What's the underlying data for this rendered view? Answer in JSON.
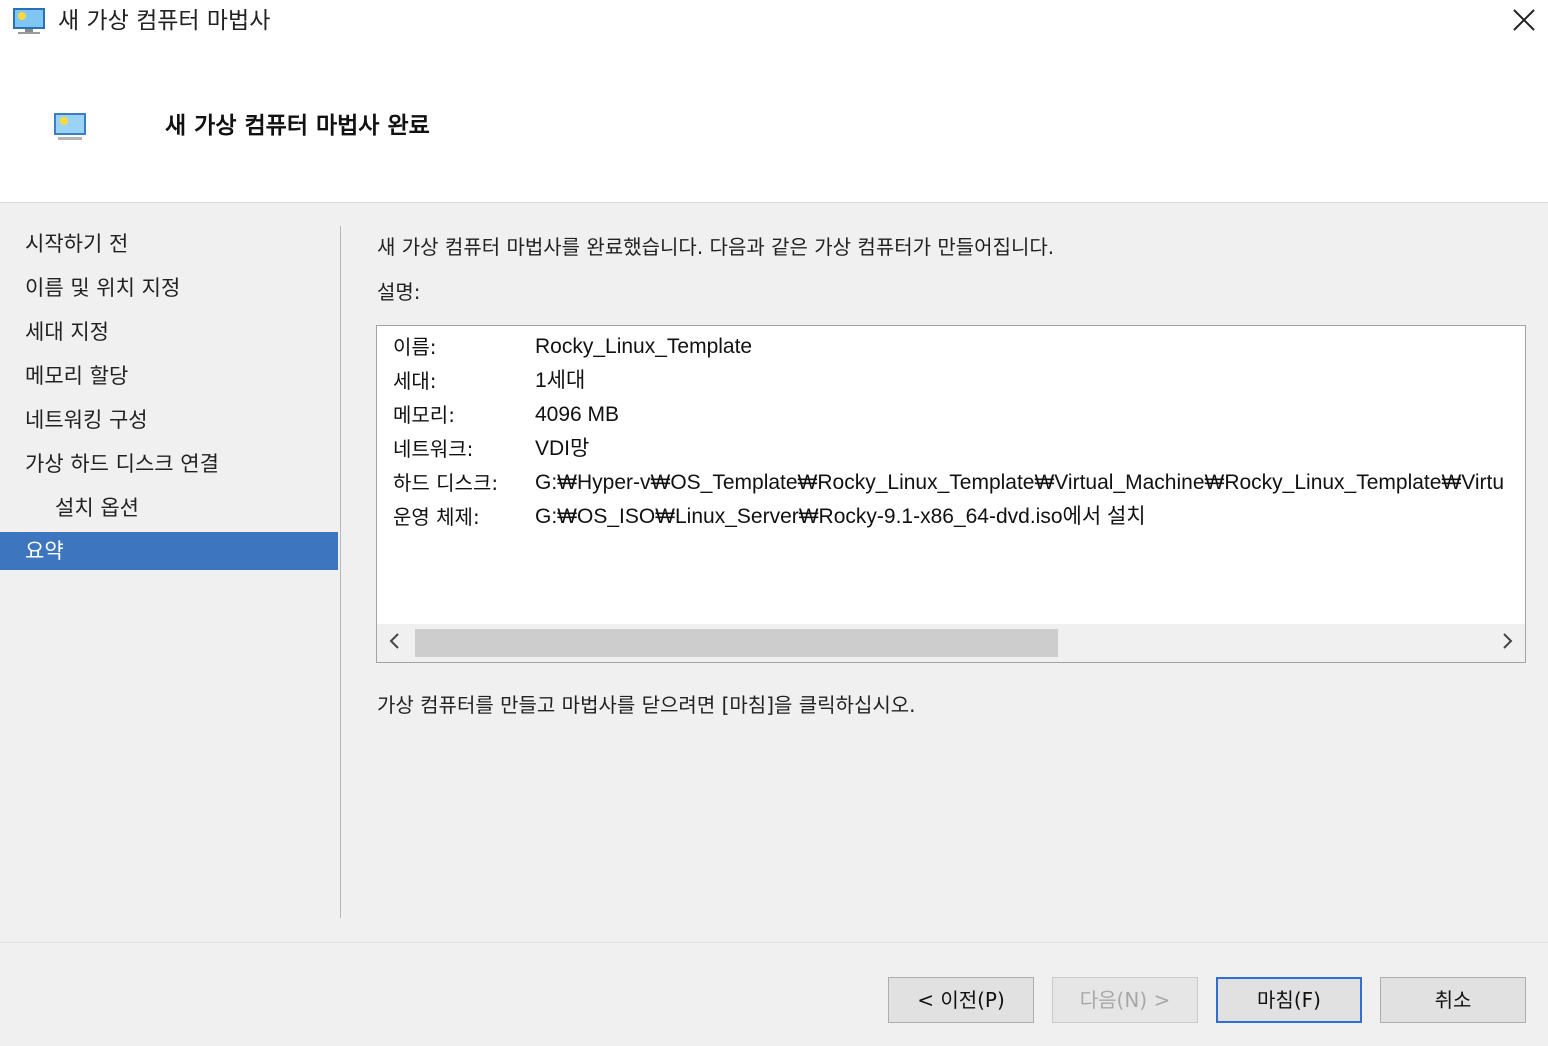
{
  "window": {
    "title": "새 가상 컴퓨터 마법사",
    "page_title": "새 가상 컴퓨터 마법사 완료",
    "icons": {
      "app": "monitor-icon",
      "close": "close-icon",
      "header": "monitor-icon"
    }
  },
  "nav": {
    "items": [
      {
        "label": "시작하기 전"
      },
      {
        "label": "이름 및 위치 지정"
      },
      {
        "label": "세대 지정"
      },
      {
        "label": "메모리 할당"
      },
      {
        "label": "네트워킹 구성"
      },
      {
        "label": "가상 하드 디스크 연결"
      },
      {
        "label": "설치 옵션"
      },
      {
        "label": "요약"
      }
    ],
    "selected": "요약"
  },
  "main": {
    "intro": "새 가상 컴퓨터 마법사를 완료했습니다. 다음과 같은 가상 컴퓨터가 만들어집니다.",
    "description_label": "설명:",
    "summary": [
      {
        "key": "이름:",
        "value": "Rocky_Linux_Template"
      },
      {
        "key": "세대:",
        "value": "1세대"
      },
      {
        "key": "메모리:",
        "value": "4096 MB"
      },
      {
        "key": "네트워크:",
        "value": "VDI망"
      },
      {
        "key": "하드 디스크:",
        "value": "G:₩Hyper-v₩OS_Template₩Rocky_Linux_Template₩Virtual_Machine₩Rocky_Linux_Template₩Virtu"
      },
      {
        "key": "운영 체제:",
        "value": "G:₩OS_ISO₩Linux_Server₩Rocky-9.1-x86_64-dvd.iso에서 설치"
      }
    ],
    "scrollbar": {
      "thumb_fraction": 0.6
    },
    "finish_note": "가상 컴퓨터를 만들고 마법사를 닫으려면 [마침]을 클릭하십시오."
  },
  "buttons": {
    "previous": "< 이전(P)",
    "next": "다음(N) >",
    "finish": "마침(F)",
    "cancel": "취소"
  },
  "colors": {
    "selected_nav": "#3d76be",
    "default_button_border": "#2f6fd0",
    "window_bg": "#f0f0f0"
  }
}
